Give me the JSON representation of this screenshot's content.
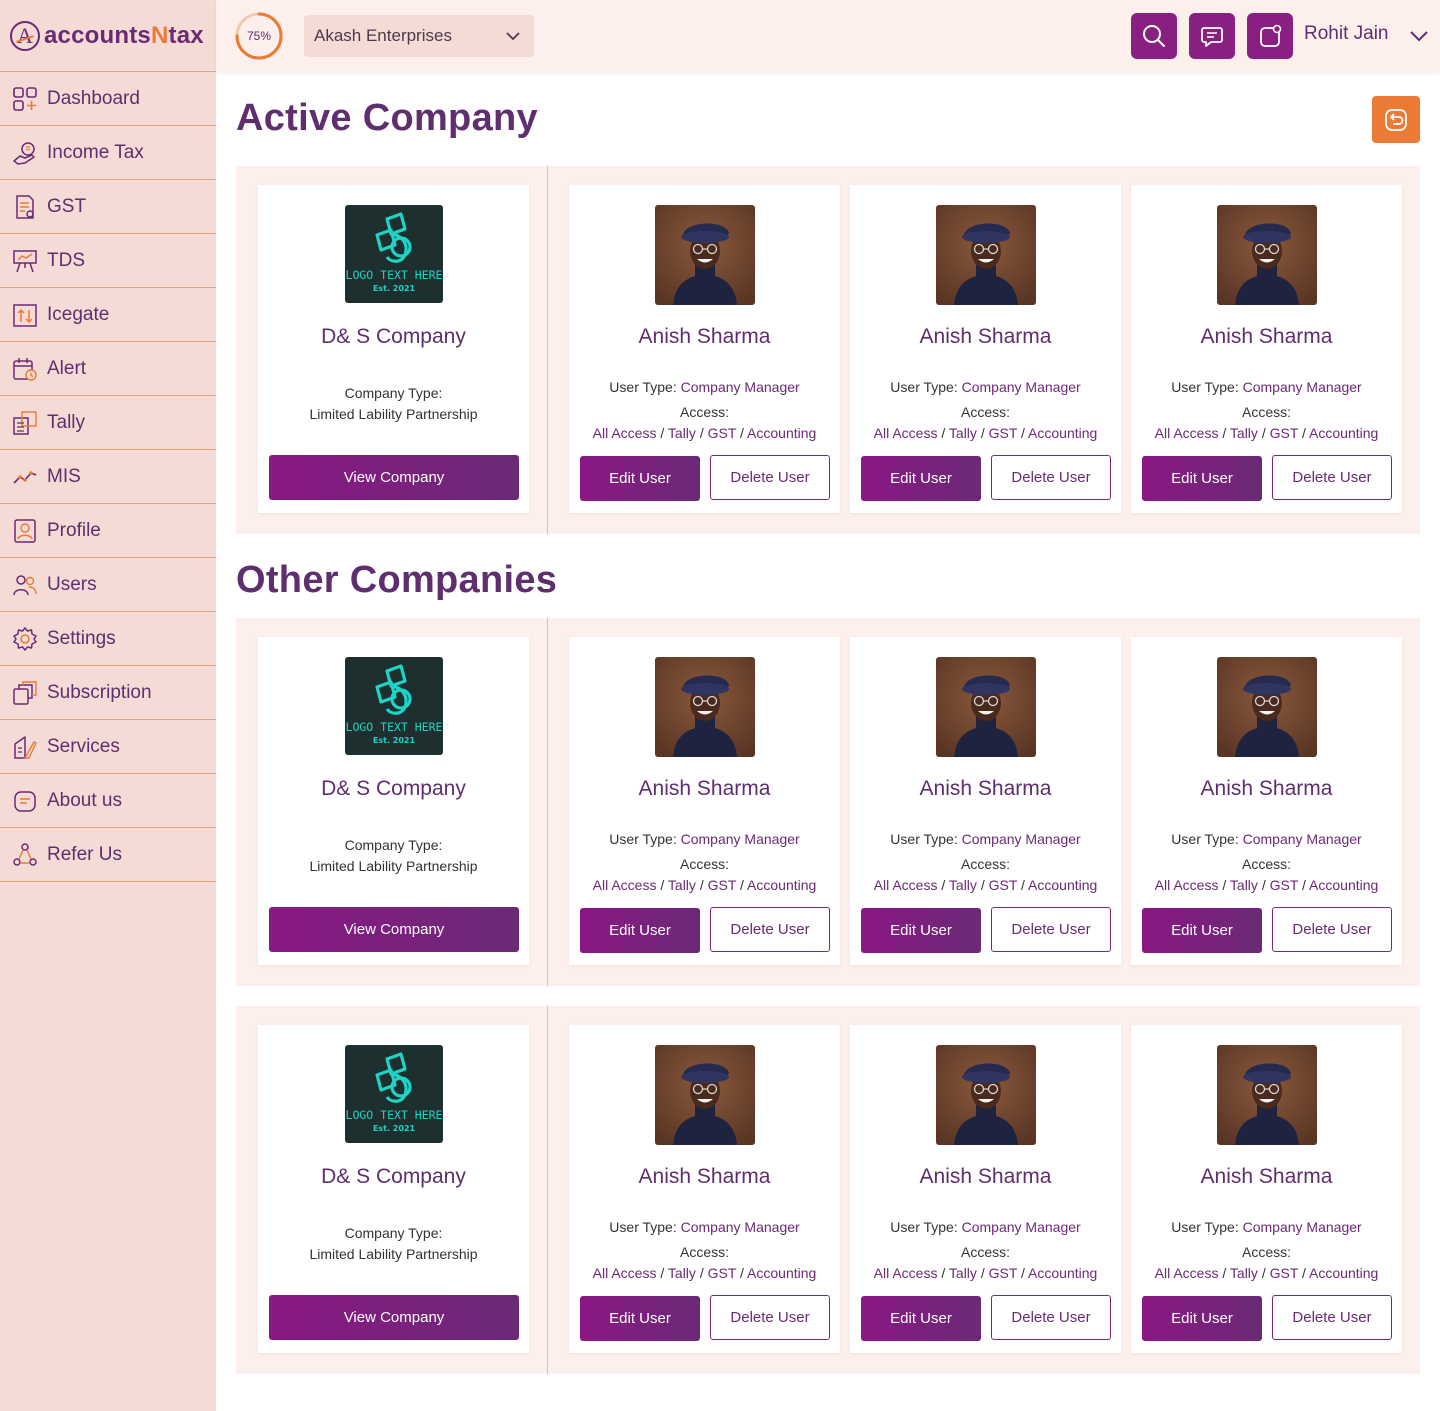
{
  "brand": {
    "prefix": "accounts",
    "accent": "N",
    "suffix": "tax",
    "mark": "A"
  },
  "sidebar": {
    "items": [
      {
        "label": "Dashboard",
        "icon": "dashboard-icon"
      },
      {
        "label": "Income Tax",
        "icon": "income-tax-icon"
      },
      {
        "label": "GST",
        "icon": "gst-icon"
      },
      {
        "label": "TDS",
        "icon": "tds-icon"
      },
      {
        "label": "Icegate",
        "icon": "icegate-icon"
      },
      {
        "label": "Alert",
        "icon": "alert-icon"
      },
      {
        "label": "Tally",
        "icon": "tally-icon"
      },
      {
        "label": "MIS",
        "icon": "mis-icon"
      },
      {
        "label": "Profile",
        "icon": "profile-icon"
      },
      {
        "label": "Users",
        "icon": "users-icon"
      },
      {
        "label": "Settings",
        "icon": "settings-icon"
      },
      {
        "label": "Subscription",
        "icon": "subscription-icon"
      },
      {
        "label": "Services",
        "icon": "services-icon"
      },
      {
        "label": "About us",
        "icon": "about-icon"
      },
      {
        "label": "Refer Us",
        "icon": "refer-icon"
      }
    ]
  },
  "header": {
    "progress_label": "75%",
    "progress_value": 0.75,
    "selected_company": "Akash Enterprises",
    "user_name": "Rohit Jain"
  },
  "sections": {
    "active_title": "Active Company",
    "other_title": "Other Companies"
  },
  "company_card": {
    "logo_text": "LOGO TEXT HERE",
    "logo_sub": "Est. 2021",
    "name": "D& S Company",
    "type_label": "Company Type:",
    "type_value": "Limited Lability Partnership",
    "button": "View Company"
  },
  "user_card": {
    "name": "Anish Sharma",
    "type_label": "User Type:",
    "type_value": "Company Manager",
    "access_label": "Access:",
    "access_items": [
      "All Access",
      "Tally",
      "GST",
      "Accounting"
    ],
    "separator": "/",
    "edit_button": "Edit User",
    "delete_button": "Delete User"
  },
  "colors": {
    "primary": "#8a1f82",
    "accent": "#ea7a34",
    "sidebar_bg": "#f5dbd6",
    "text": "#5e2e6e"
  }
}
